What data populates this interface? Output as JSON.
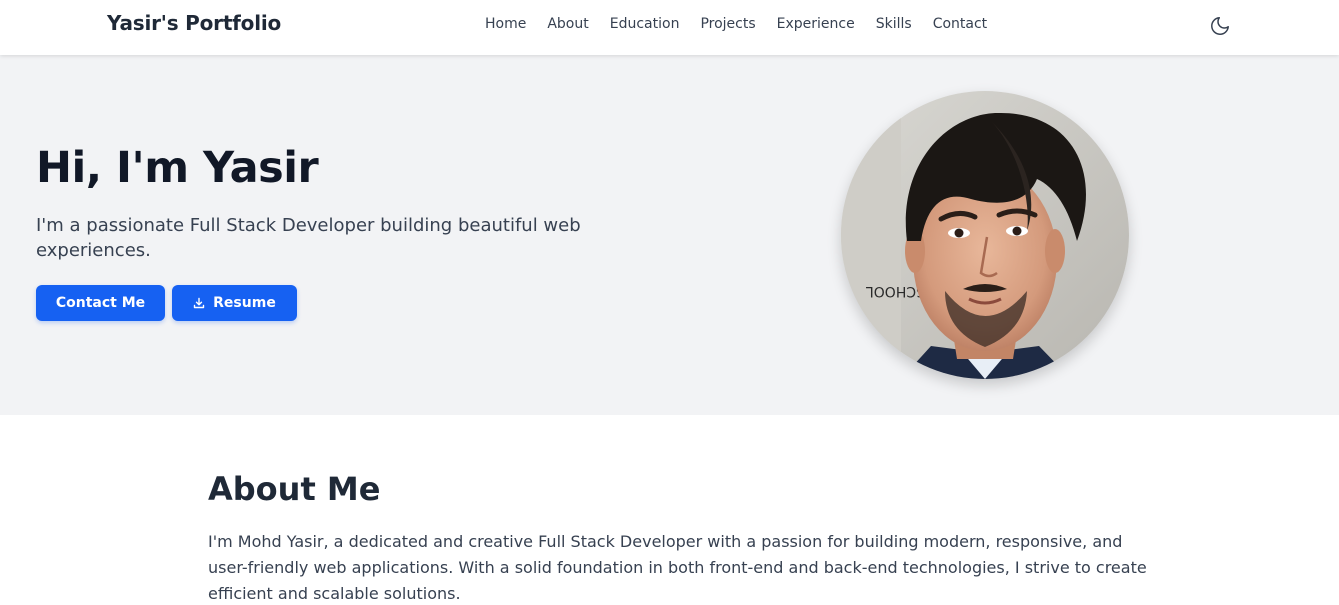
{
  "navbar": {
    "brand": "Yasir's Portfolio",
    "links": [
      "Home",
      "About",
      "Education",
      "Projects",
      "Experience",
      "Skills",
      "Contact"
    ],
    "theme_icon": "moon-icon"
  },
  "hero": {
    "title": "Hi, I'm Yasir",
    "subtitle": "I'm a passionate Full Stack Developer building beautiful web experiences.",
    "contact_button": "Contact Me",
    "resume_button": "Resume",
    "resume_icon": "download-icon"
  },
  "about": {
    "title": "About Me",
    "text": "I'm Mohd Yasir, a dedicated and creative Full Stack Developer with a passion for building modern, responsive, and user-friendly web applications. With a solid foundation in both front-end and back-end technologies, I strive to create efficient and scalable solutions."
  },
  "colors": {
    "accent": "#1661f2",
    "hero_background": "#f2f3f5",
    "heading": "#111827",
    "body_text": "#374151"
  }
}
